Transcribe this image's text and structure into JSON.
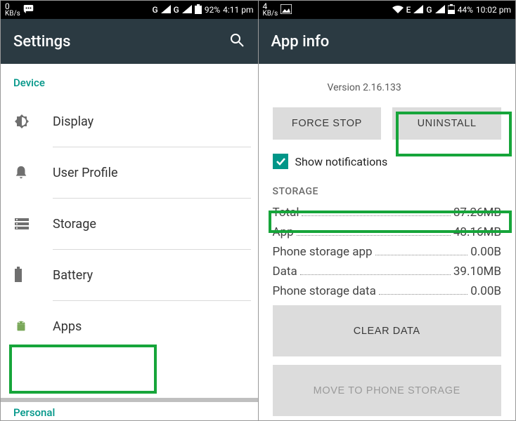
{
  "left": {
    "status": {
      "kb_num": "0",
      "kb_unit": "KB/s",
      "net": "G",
      "battery": "92%",
      "time": "4:11 pm"
    },
    "app_title": "Settings",
    "section_device": "Device",
    "items": [
      {
        "label": "Display"
      },
      {
        "label": "User Profile"
      },
      {
        "label": "Storage"
      },
      {
        "label": "Battery"
      },
      {
        "label": "Apps"
      }
    ],
    "section_personal": "Personal"
  },
  "right": {
    "status": {
      "kb_num": "4",
      "kb_unit": "KB/s",
      "net": "E",
      "battery": "44%",
      "time": "10:02 pm"
    },
    "app_title": "App info",
    "version": "Version 2.16.133",
    "btn_force_stop": "FORCE STOP",
    "btn_uninstall": "UNINSTALL",
    "show_notifications": "Show notifications",
    "storage_head": "STORAGE",
    "storage": [
      {
        "k": "Total",
        "v": "87.26MB"
      },
      {
        "k": "App",
        "v": "48.16MB"
      },
      {
        "k": "Phone storage app",
        "v": "0.00B"
      },
      {
        "k": "Data",
        "v": "39.10MB"
      },
      {
        "k": "Phone storage data",
        "v": "0.00B"
      }
    ],
    "btn_clear_data": "CLEAR DATA",
    "btn_move": "MOVE TO PHONE STORAGE"
  }
}
